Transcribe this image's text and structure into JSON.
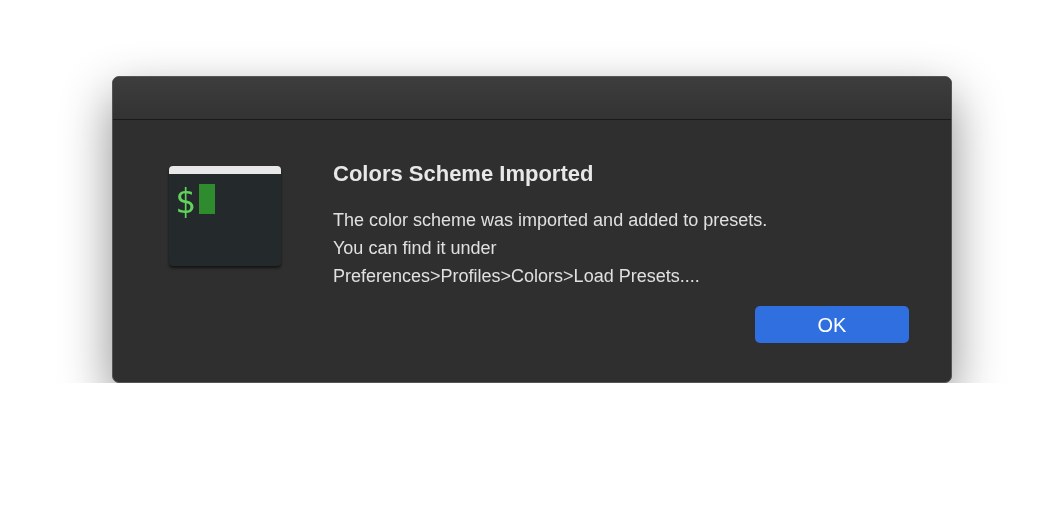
{
  "dialog": {
    "app_icon": {
      "prompt": "$"
    },
    "title": "Colors Scheme Imported",
    "message_lines": [
      "The color scheme was imported and added to presets.",
      "You can find it under",
      "Preferences>Profiles>Colors>Load Presets...."
    ],
    "buttons": [
      {
        "label": "OK",
        "default": true
      }
    ]
  }
}
